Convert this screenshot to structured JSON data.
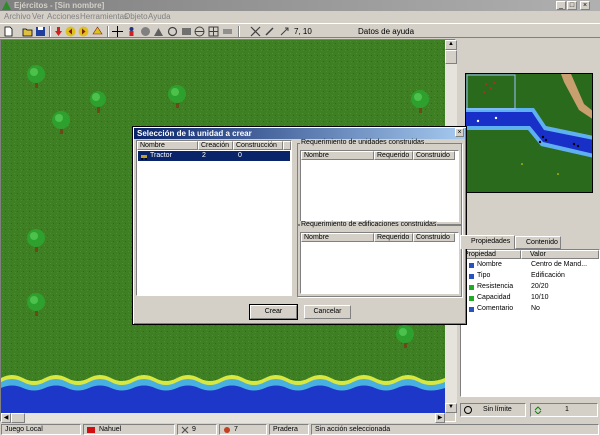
{
  "window": {
    "title": "Ejércitos - [Sin nombre]",
    "controls": {
      "minimize": "_",
      "maximize": "□",
      "close": "×"
    }
  },
  "menu": [
    "Archivo",
    "Ver",
    "Acciones",
    "Herramientas",
    "Objeto",
    "Ayuda"
  ],
  "toolbar": {
    "icons": [
      "new-icon",
      "open-icon",
      "save-icon",
      "move-down-icon",
      "arrow-left-icon",
      "arrow-right-icon",
      "arrow-up-icon",
      "crosshair-icon",
      "person-icon",
      "info-icon",
      "build-icon",
      "zoom-icon",
      "map-icon",
      "cut-icon",
      "pencil-icon",
      "coords-icon"
    ],
    "coords": "7, 10",
    "help": "Datos de ayuda"
  },
  "dialog": {
    "title": "Selección de la unidad a crear",
    "close": "×",
    "units_table": {
      "columns": [
        "Nombre",
        "Creación",
        "Construcción"
      ],
      "rows": [
        {
          "name": "Tractor",
          "creacion": "2",
          "construccion": "0"
        }
      ]
    },
    "req_units": {
      "label": "Requerimiento de unidades construidas",
      "columns": [
        "Nombre",
        "Requerido",
        "Construido"
      ]
    },
    "req_buildings": {
      "label": "Requerimiento de edificaciones construidas",
      "columns": [
        "Nombre",
        "Requerido",
        "Construido"
      ]
    },
    "buttons": {
      "create": "Crear",
      "cancel": "Cancelar"
    }
  },
  "right_panel": {
    "tabs": [
      "Propiedades",
      "Contenido"
    ],
    "properties_header": [
      "Propiedad",
      "Valor"
    ],
    "properties": [
      {
        "key": "Nombre",
        "value": "Centro de Mand...",
        "color": "#2a52be"
      },
      {
        "key": "Tipo",
        "value": "Edificación",
        "color": "#2a52be"
      },
      {
        "key": "Resistencia",
        "value": "20/20",
        "color": "#22aa22"
      },
      {
        "key": "Capacidad",
        "value": "10/10",
        "color": "#22aa22"
      },
      {
        "key": "Comentario",
        "value": "No",
        "color": "#2a52be"
      }
    ],
    "time_limit": "Sin límite",
    "turn": "1"
  },
  "status": {
    "mode": "Juego Local",
    "player": "Nahuel",
    "player_color": "#d01010",
    "res1": "9",
    "res2": "7",
    "terrain": "Pradera",
    "action": "Sin acción seleccionada"
  }
}
